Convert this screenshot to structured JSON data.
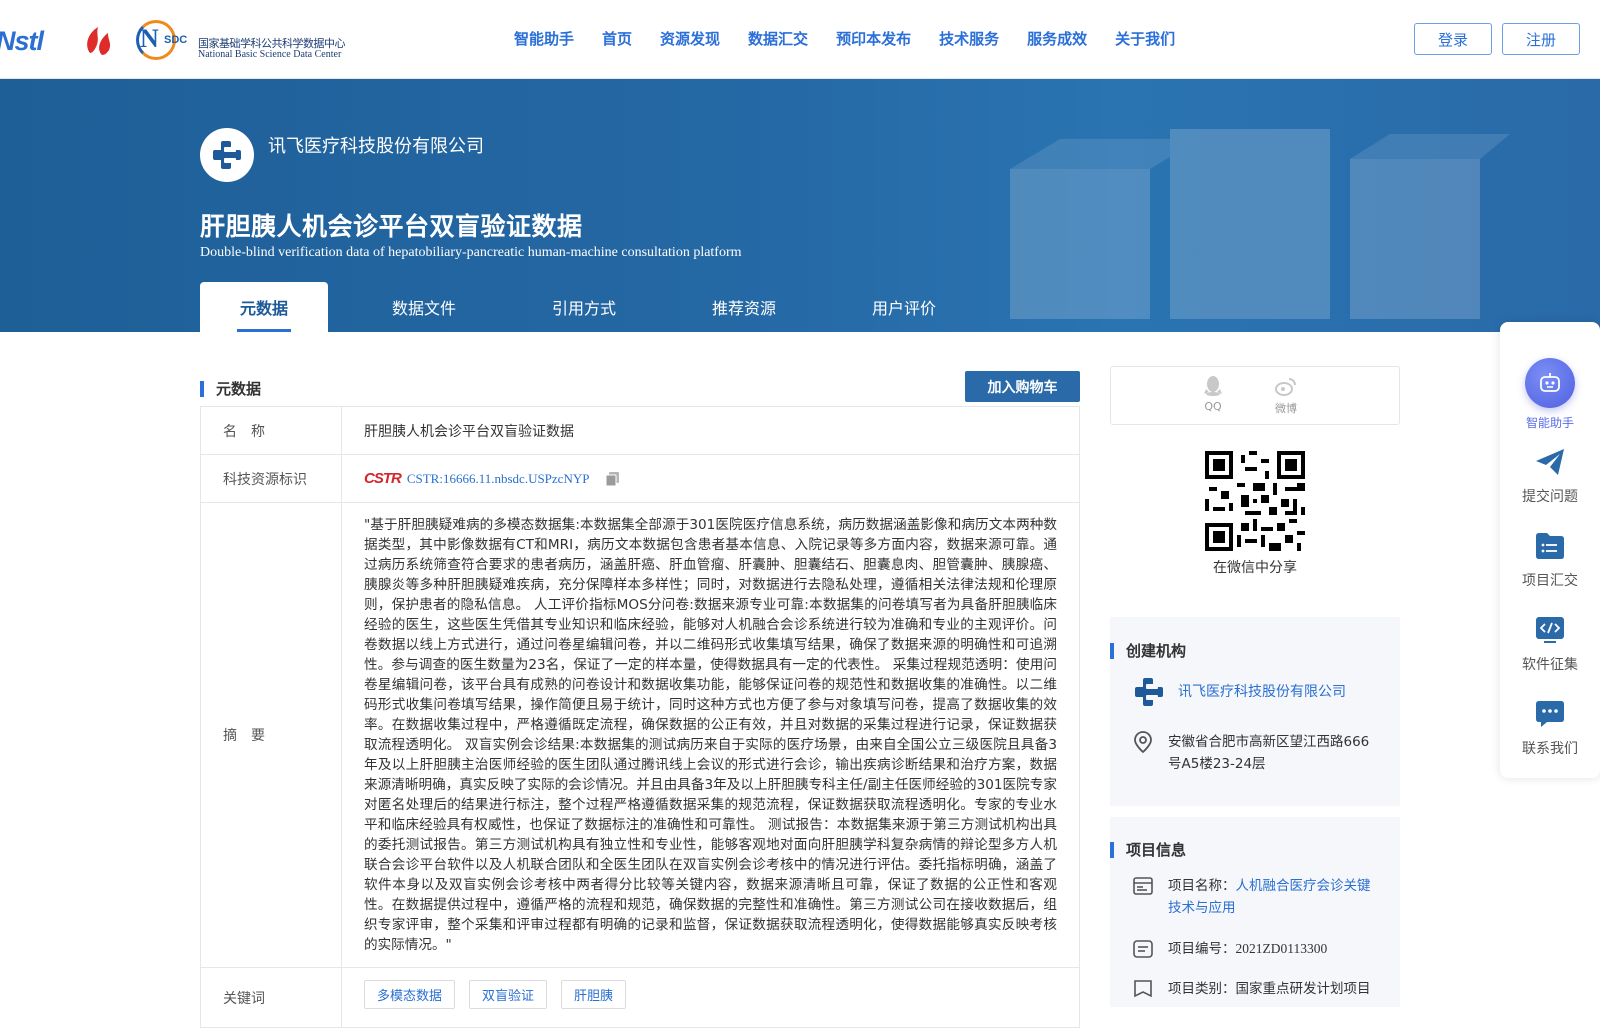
{
  "header": {
    "logo_nstl": "Nstl",
    "logo_nsdc_mark": "N",
    "logo_nsdc_sdc": "SDC",
    "logo_nsdc_cn": "国家基础学科公共科学数据中心",
    "logo_nsdc_en": "National Basic Science Data Center",
    "nav": [
      "智能助手",
      "首页",
      "资源发现",
      "数据汇交",
      "预印本发布",
      "技术服务",
      "服务成效",
      "关于我们"
    ],
    "login": "登录",
    "register": "注册"
  },
  "banner": {
    "org_name": "讯飞医疗科技股份有限公司",
    "title_cn": "肝胆胰人机会诊平台双盲验证数据",
    "title_en": "Double-blind verification data of hepatobiliary-pancreatic human-machine consultation platform",
    "tabs": [
      "元数据",
      "数据文件",
      "引用方式",
      "推荐资源",
      "用户评价"
    ]
  },
  "metadata": {
    "section_title": "元数据",
    "cart_button": "加入购物车",
    "rows": {
      "name_key": "名　称",
      "name_value": "肝胆胰人机会诊平台双盲验证数据",
      "id_key": "科技资源标识",
      "id_logo": "CSTR",
      "id_value": "CSTR:16666.11.nbsdc.USPzcNYP",
      "abstract_key": "摘　要",
      "abstract_value": "\"基于肝胆胰疑难病的多模态数据集:本数据集全部源于301医院医疗信息系统，病历数据涵盖影像和病历文本两种数据类型，其中影像数据有CT和MRI，病历文本数据包含患者基本信息、入院记录等多方面内容，数据来源可靠。通过病历系统筛查符合要求的患者病历，涵盖肝癌、肝血管瘤、肝囊肿、胆囊结石、胆囊息肉、胆管囊肿、胰腺癌、胰腺炎等多种肝胆胰疑难疾病，充分保障样本多样性；同时，对数据进行去隐私处理，遵循相关法律法规和伦理原则，保护患者的隐私信息。 人工评价指标MOS分问卷:数据来源专业可靠:本数据集的问卷填写者为具备肝胆胰临床经验的医生，这些医生凭借其专业知识和临床经验，能够对人机融合会诊系统进行较为准确和专业的主观评价。问卷数据以线上方式进行，通过问卷星编辑问卷，并以二维码形式收集填写结果，确保了数据来源的明确性和可追溯性。参与调查的医生数量为23名，保证了一定的样本量，使得数据具有一定的代表性。 采集过程规范透明：使用问卷星编辑问卷，该平台具有成熟的问卷设计和数据收集功能，能够保证问卷的规范性和数据收集的准确性。以二维码形式收集问卷填写结果，操作简便且易于统计，同时这种方式也方便了参与对象填写问卷，提高了数据收集的效率。在数据收集过程中，严格遵循既定流程，确保数据的公正有效，并且对数据的采集过程进行记录，保证数据获取流程透明化。 双盲实例会诊结果:本数据集的测试病历来自于实际的医疗场景，由来自全国公立三级医院且具备3年及以上肝胆胰主治医师经验的医生团队通过腾讯线上会议的形式进行会诊，输出疾病诊断结果和治疗方案，数据来源清晰明确，真实反映了实际的会诊情况。并且由具备3年及以上肝胆胰专科主任/副主任医师经验的301医院专家对匿名处理后的结果进行标注，整个过程严格遵循数据采集的规范流程，保证数据获取流程透明化。专家的专业水平和临床经验具有权威性，也保证了数据标注的准确性和可靠性。 测试报告：本数据集来源于第三方测试机构出具的委托测试报告。第三方测试机构具有独立性和专业性，能够客观地对面向肝胆胰学科复杂病情的辩论型多方人机联合会诊平台软件以及人机联合团队和全医生团队在双盲实例会诊考核中的情况进行评估。委托指标明确，涵盖了软件本身以及双盲实例会诊考核中两者得分比较等关键内容，数据来源清晰且可靠，保证了数据的公正性和客观性。在数据提供过程中，遵循严格的流程和规范，确保数据的完整性和准确性。第三方测试公司在接收数据后，组织专家评审，整个采集和评审过程都有明确的记录和监督，保证数据获取流程透明化，使得数据能够真实反映考核的实际情况。\"",
      "keywords_key": "关键词",
      "keywords": [
        "多模态数据",
        "双盲验证",
        "肝胆胰"
      ]
    }
  },
  "share": {
    "qq": "QQ",
    "weibo": "微博",
    "wechat_caption": "在微信中分享"
  },
  "creator": {
    "section_title": "创建机构",
    "org_name": "讯飞医疗科技股份有限公司",
    "address": "安徽省合肥市高新区望江西路666号A5楼23-24层"
  },
  "project": {
    "section_title": "项目信息",
    "name_label": "项目名称：",
    "name_value": "人机融合医疗会诊关键技术与应用",
    "code_label": "项目编号：",
    "code_value": "2021ZD0113300",
    "type_label": "项目类别：",
    "type_value": "国家重点研发计划项目"
  },
  "float_bar": {
    "items": [
      "智能助手",
      "提交问题",
      "项目汇交",
      "软件征集",
      "联系我们"
    ]
  },
  "colors": {
    "primary": "#2b6fd8",
    "banner": "#2468a4",
    "ai_accent": "#5a6be8"
  }
}
